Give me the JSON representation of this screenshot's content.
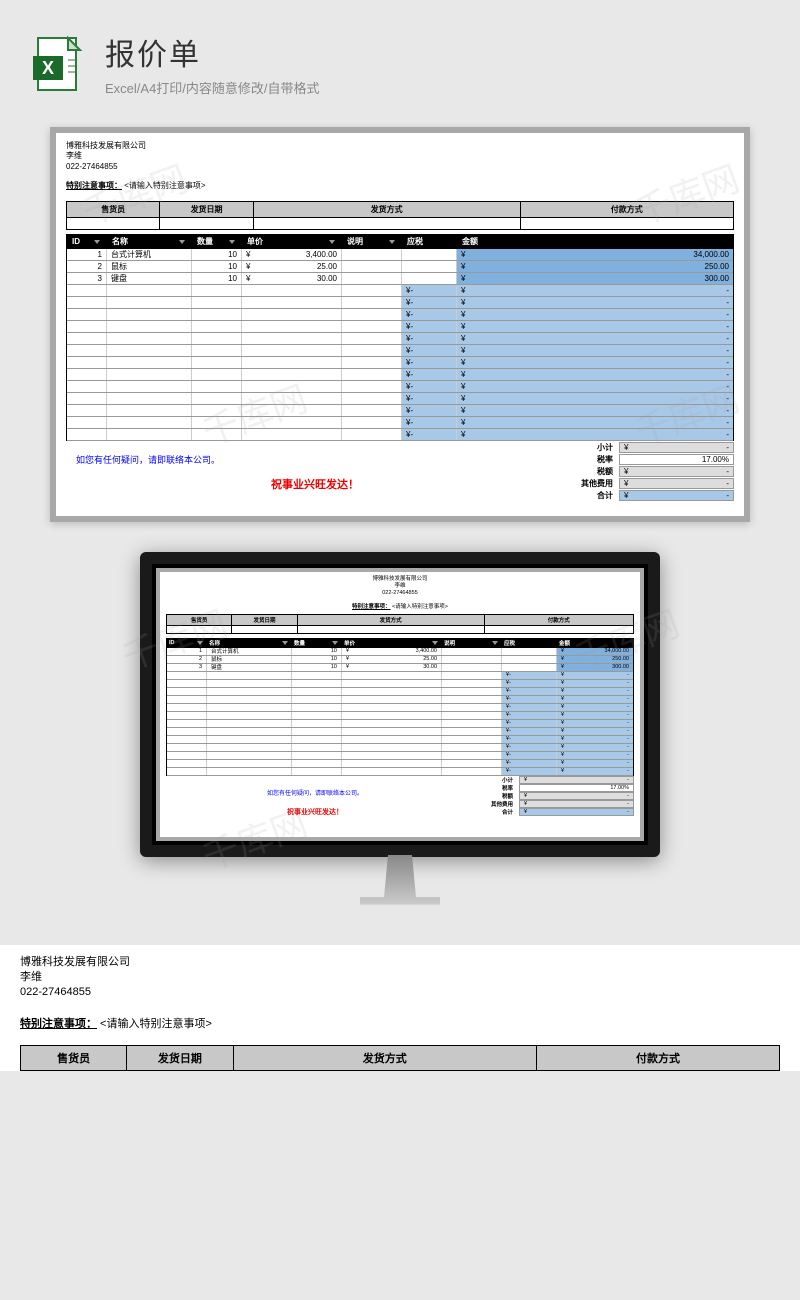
{
  "header": {
    "title": "报价单",
    "subtitle": "Excel/A4打印/内容随意修改/自带格式"
  },
  "company": {
    "name": "博雅科技发展有限公司",
    "contact": "李维",
    "phone": "022-27464855"
  },
  "notice": {
    "label": "特别注意事项：",
    "placeholder": "<请输入特别注意事项>"
  },
  "ship_header": {
    "sales": "售货员",
    "date": "发货日期",
    "method": "发货方式",
    "payment": "付款方式"
  },
  "cols": {
    "id": "ID",
    "name": "名称",
    "qty": "数量",
    "price": "单价",
    "desc": "说明",
    "tax": "应税",
    "amount": "金额"
  },
  "items": [
    {
      "id": "1",
      "name": "台式计算机",
      "qty": "10",
      "price": "3,400.00",
      "desc": "",
      "tax": "",
      "amount": "34,000.00"
    },
    {
      "id": "2",
      "name": "鼠标",
      "qty": "10",
      "price": "25.00",
      "desc": "",
      "tax": "",
      "amount": "250.00"
    },
    {
      "id": "3",
      "name": "键盘",
      "qty": "10",
      "price": "30.00",
      "desc": "",
      "tax": "",
      "amount": "300.00"
    }
  ],
  "currency": "¥",
  "totals": {
    "subtotal": {
      "label": "小计",
      "value": "-"
    },
    "taxrate": {
      "label": "税率",
      "value": "17.00%"
    },
    "taxamt": {
      "label": "税额",
      "value": "-"
    },
    "other": {
      "label": "其他费用",
      "value": "-"
    },
    "total": {
      "label": "合计",
      "value": "-"
    }
  },
  "messages": {
    "contact": "如您有任何疑问，请即联络本公司。",
    "wish": "祝事业兴旺发达！"
  },
  "watermark": "千库网"
}
